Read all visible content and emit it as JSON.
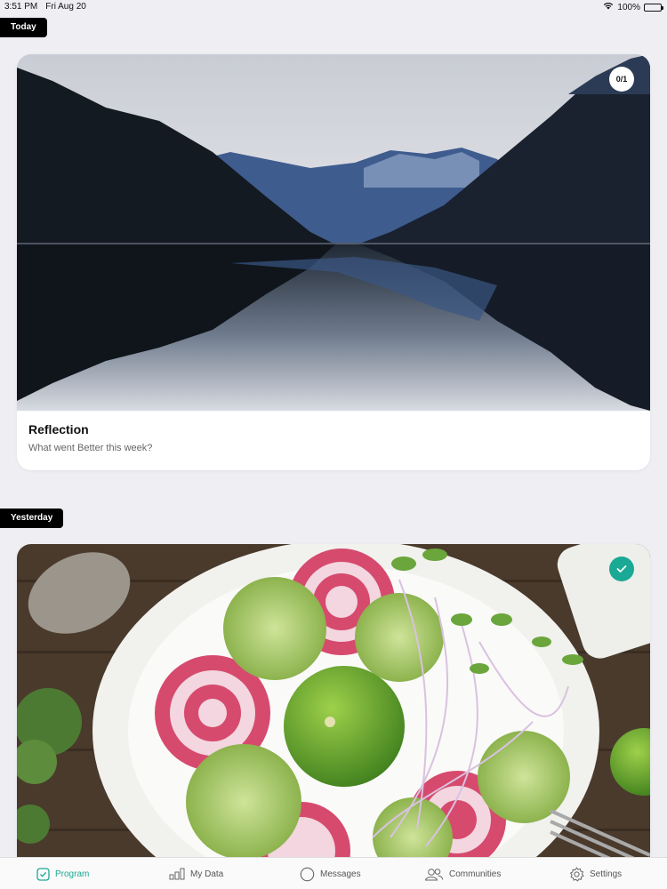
{
  "status_bar": {
    "time": "3:51 PM",
    "date": "Fri Aug 20",
    "battery": "100%"
  },
  "feed": {
    "today_label": "Today",
    "yesterday_label": "Yesterday",
    "cards": [
      {
        "title": "Reflection",
        "subtitle": "What went Better this week?",
        "progress": "0/1",
        "image": "mountain-lake-photo"
      },
      {
        "completed": true,
        "image": "beet-tomatillo-salad-photo"
      }
    ]
  },
  "tab_bar": {
    "items": [
      {
        "label": "Program",
        "icon": "checkbox-icon",
        "active": true
      },
      {
        "label": "My Data",
        "icon": "bar-chart-icon",
        "active": false
      },
      {
        "label": "Messages",
        "icon": "chat-bubble-icon",
        "active": false
      },
      {
        "label": "Communities",
        "icon": "people-icon",
        "active": false
      },
      {
        "label": "Settings",
        "icon": "gear-icon",
        "active": false
      }
    ]
  },
  "colors": {
    "accent": "#1aa994",
    "background": "#efeef3",
    "label_bg": "#000000"
  }
}
